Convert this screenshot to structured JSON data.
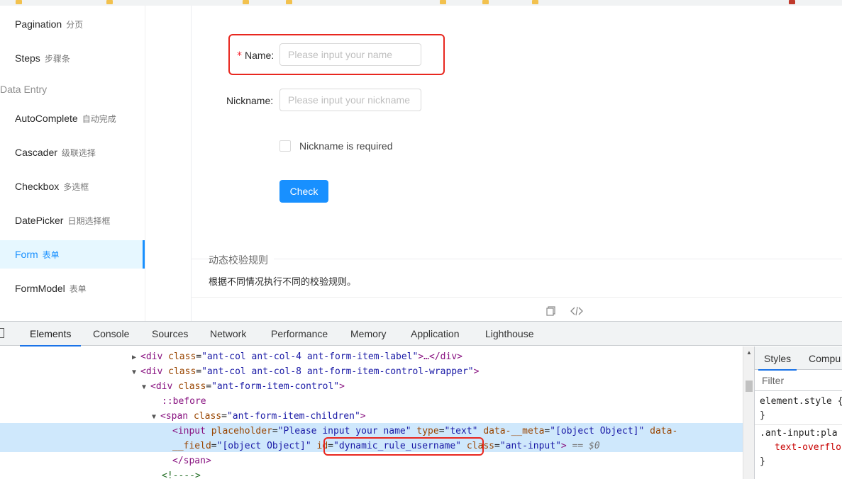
{
  "sidebar": {
    "items": [
      {
        "label": "Pagination",
        "cn": "分页"
      },
      {
        "label": "Steps",
        "cn": "步骤条"
      },
      {
        "label": "AutoComplete",
        "cn": "自动完成"
      },
      {
        "label": "Cascader",
        "cn": "级联选择"
      },
      {
        "label": "Checkbox",
        "cn": "多选框"
      },
      {
        "label": "DatePicker",
        "cn": "日期选择框"
      },
      {
        "label": "Form",
        "cn": "表单"
      },
      {
        "label": "FormModel",
        "cn": "表单"
      }
    ],
    "group_label": "Data Entry"
  },
  "form": {
    "name_required_mark": "*",
    "name_label": "Name",
    "name_placeholder": "Please input your name",
    "nickname_label": "Nickname",
    "nickname_placeholder": "Please input your nickname",
    "checkbox_label": "Nickname is required",
    "check_button": "Check",
    "label_colon": ":"
  },
  "demo_meta": {
    "title": "动态校验规则",
    "description": "根据不同情况执行不同的校验规则。"
  },
  "devtools": {
    "tabs": [
      "Elements",
      "Console",
      "Sources",
      "Network",
      "Performance",
      "Memory",
      "Application",
      "Lighthouse"
    ],
    "active_tab": "Elements",
    "dom": {
      "line1_tag_open": "<div",
      "line1_attr": "class",
      "line1_val": "\"ant-col ant-col-4 ant-form-item-label\"",
      "line1_tail": ">…</div>",
      "line2_tag_open": "<div",
      "line2_attr": "class",
      "line2_val": "\"ant-col ant-col-8 ant-form-item-control-wrapper\"",
      "line2_tail": ">",
      "line3_tag_open": "<div",
      "line3_attr": "class",
      "line3_val": "\"ant-form-item-control\"",
      "line3_tail": ">",
      "line4_pseudo": "::before",
      "line5_tag_open": "<span",
      "line5_attr": "class",
      "line5_val": "\"ant-form-item-children\"",
      "line5_tail": ">",
      "line6_tag_open": "<input",
      "line6_attr1": "placeholder",
      "line6_val1": "\"Please input your name\"",
      "line6_attr2": "type",
      "line6_val2": "\"text\"",
      "line6_attr3": "data-__meta",
      "line6_val3": "\"[object Object]\"",
      "line6_attr4": "data-",
      "line7_attr4b": "__field",
      "line7_val4": "\"[object Object]\"",
      "line7_attr5": "id",
      "line7_val5": "\"dynamic_rule_username\"",
      "line7_attr6": "class",
      "line7_val6": "\"ant-input\"",
      "line7_tail": ">",
      "line7_eq": "== $0",
      "line8_tag": "</span>",
      "line9_comment": "<!---->"
    },
    "styles": {
      "tabs": [
        "Styles",
        "Compu"
      ],
      "filter_placeholder": "Filter",
      "rule1_selector": "element.style",
      "rule1_open": "{",
      "rule1_close": "}",
      "rule2_selector": ".ant-input:pla",
      "rule2_prop": "text-overflo",
      "rule2_close": "}"
    }
  }
}
